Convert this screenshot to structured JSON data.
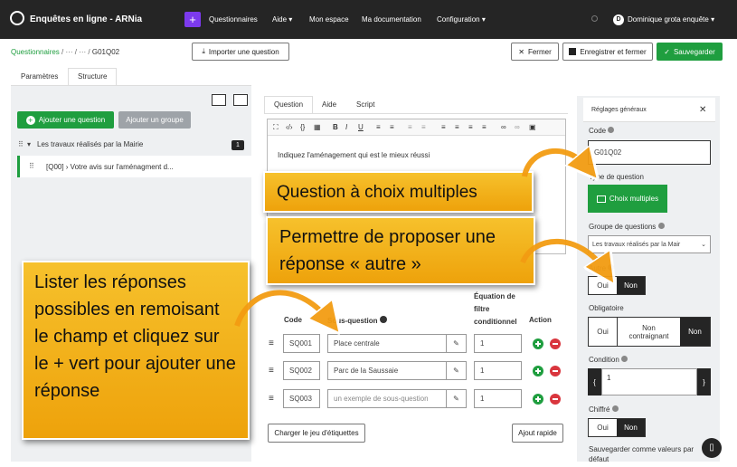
{
  "app": {
    "title": "Enquêtes en ligne - ARNia"
  },
  "nav": {
    "questionnaires": "Questionnaires",
    "aide": "Aide",
    "mon_espace": "Mon espace",
    "ma_documentation": "Ma documentation",
    "configuration": "Configuration",
    "user_initial": "D",
    "user_name": "Dominique grota enquête"
  },
  "breadcrumb": {
    "root": "Questionnaires",
    "sep1": "/ ··· /",
    "sep2": "··· /",
    "current": "G01Q02"
  },
  "toolbar": {
    "import": "Importer une question",
    "fermer": "Fermer",
    "enregistrer_fermer": "Enregistrer et fermer",
    "sauvegarder": "Sauvegarder"
  },
  "left": {
    "tab_parametres": "Paramètres",
    "tab_structure": "Structure",
    "add_question": "Ajouter une question",
    "add_group": "Ajouter un groupe",
    "group_name": "Les travaux réalisés par la Mairie",
    "group_count": "1",
    "question_item": "[Q00] › Votre avis sur l'aménagment d..."
  },
  "editor": {
    "tab_question": "Question",
    "tab_aide": "Aide",
    "tab_script": "Script",
    "text": "Indiquez l'aménagement qui est le mieux réussi"
  },
  "subq": {
    "col_code": "Code",
    "col_sous_question": "Sous-question",
    "col_eq_line1": "Équation de",
    "col_eq_line2": "filtre",
    "col_eq_line3": "conditionnel",
    "col_action": "Action",
    "rows": [
      {
        "code": "SQ001",
        "text": "Place centrale",
        "eq": "1"
      },
      {
        "code": "SQ002",
        "text": "Parc de la Saussaie",
        "eq": "1"
      },
      {
        "code": "SQ003",
        "text": "un exemple de sous-question",
        "eq": "1"
      }
    ],
    "charger": "Charger le jeu d'étiquettes",
    "ajout_rapide": "Ajout rapide"
  },
  "right": {
    "title": "Réglages généraux",
    "code_label": "Code",
    "code_value": "G01Q02",
    "type_label": "Type de question",
    "type_value": "Choix multiples",
    "groupe_label": "Groupe de questions",
    "groupe_value": "Les travaux réalisés par la Mair",
    "autre_label": "Autre",
    "oui": "Oui",
    "non": "Non",
    "obligatoire_label": "Obligatoire",
    "non_contraignant": "Non contraignant",
    "condition_label": "Condition",
    "condition_value": "1",
    "chiffre_label": "Chiffré",
    "sauvegarder_label": "Sauvegarder comme valeurs par défaut"
  },
  "callouts": {
    "choix_multiples": "Question à choix multiples",
    "autre": "Permettre de proposer une réponse « autre »",
    "lister": "Lister les réponses possibles en remoisant le champ et cliquez sur le + vert pour ajouter une réponse"
  },
  "colors": {
    "navbar": "#252525",
    "accent_purple": "#7c3aed",
    "green": "#1f9e3f",
    "callout": "#f2b21a"
  }
}
